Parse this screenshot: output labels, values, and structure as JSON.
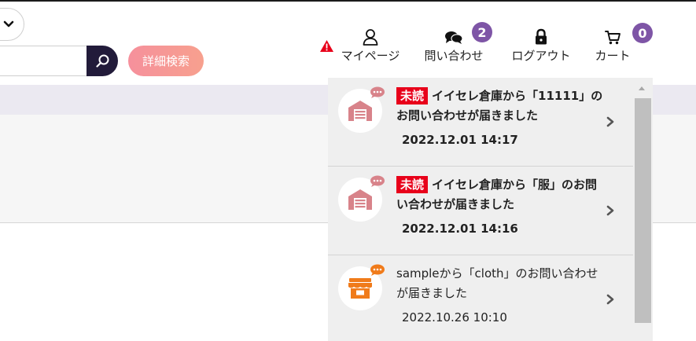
{
  "colors": {
    "badge": "#7e55a6",
    "unread": "#e8001a",
    "search_button": "#221b3a",
    "advanced_button": "#f6909c"
  },
  "search": {
    "value": "",
    "placeholder": ""
  },
  "advanced_search": {
    "label": "詳細検索"
  },
  "nav": {
    "mypage": {
      "label": "マイページ",
      "icon": "user-icon"
    },
    "inquiry": {
      "label": "問い合わせ",
      "icon": "chat-bubbles-icon",
      "badge": "2"
    },
    "logout": {
      "label": "ログアウト",
      "icon": "lock-icon"
    },
    "cart": {
      "label": "カート",
      "icon": "cart-icon",
      "badge": "0"
    }
  },
  "notifications": [
    {
      "tag": "未読",
      "text": "イイセレ倉庫から「11111」のお問い合わせが届きました",
      "date": "2022.12.01 14:17",
      "icon": "warehouse-icon",
      "unread": true
    },
    {
      "tag": "未読",
      "text": "イイセレ倉庫から「服」のお問い合わせが届きました",
      "date": "2022.12.01 14:16",
      "icon": "warehouse-icon",
      "unread": true
    },
    {
      "tag": "",
      "text": "sampleから「cloth」のお問い合わせが届きました",
      "date": "2022.10.26 10:10",
      "icon": "shop-icon",
      "unread": false
    }
  ]
}
